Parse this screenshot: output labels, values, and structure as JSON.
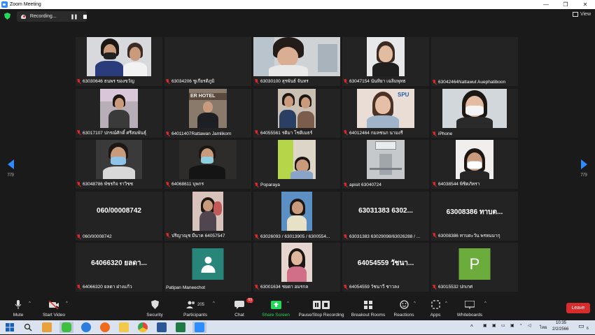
{
  "window": {
    "title": "Zoom Meeting"
  },
  "topbar": {
    "recording_label": "Recording...",
    "view_label": "View"
  },
  "pager": {
    "left_label": "7/9",
    "right_label": "7/9"
  },
  "participants": [
    {
      "name": "63030646 ธนพร ของขวัญ",
      "kind": "video"
    },
    {
      "name": "63034206 ชูเกียรติภูมิ",
      "kind": "dark"
    },
    {
      "name": "63030100 สุรพันธ์ จันทร",
      "kind": "video"
    },
    {
      "name": "63047154 นันทิยา เฉลิมพุทธ",
      "kind": "video"
    },
    {
      "name": "63042464Nattawut Auephatiboon",
      "kind": "dark"
    },
    {
      "name": "63017107 ปกรณ์ศักดิ์ ศรีสมพันธุ์",
      "kind": "video"
    },
    {
      "name": "64011407Rattawan Jamlikorn",
      "kind": "video",
      "video_caption": "ER HOTEL"
    },
    {
      "name": "64055561 รติมา โชติเมธร์",
      "kind": "video"
    },
    {
      "name": "64012464 กมลชนก นามงรี",
      "kind": "video",
      "video_caption": "SPU"
    },
    {
      "name": "iPhone",
      "kind": "video"
    },
    {
      "name": "63048786 พัชรกิจ ราวิชช",
      "kind": "video"
    },
    {
      "name": "64068611 บุพกร",
      "kind": "video"
    },
    {
      "name": "Poparaya",
      "kind": "video"
    },
    {
      "name": "apisit 63040724",
      "kind": "video"
    },
    {
      "name": "64038544 พิชิตภัทรา",
      "kind": "video"
    },
    {
      "name": "060/00008742",
      "kind": "text",
      "big": "060/00008742"
    },
    {
      "name": "ปริญาณุช มีนาค 64057547",
      "kind": "video"
    },
    {
      "name": "63026093 / 63013905 / 6300554...",
      "kind": "video"
    },
    {
      "name": "63031383 63029098/63026288 / ...",
      "kind": "text",
      "big": "63031383 6302..."
    },
    {
      "name": "63008386 ทาบตะวัน พรหมมากุ",
      "kind": "text",
      "big": "63008386 ทาบต..."
    },
    {
      "name": "64066320 ยลดา ฝางแก้ว",
      "kind": "text",
      "big": "64066320 ยลดา..."
    },
    {
      "name": "Patipan Maneechot",
      "kind": "avatar"
    },
    {
      "name": "63001634 ชยดา อมรกล",
      "kind": "video"
    },
    {
      "name": "64054559 วัชนาวี ชาวลง",
      "kind": "text",
      "big": "64054559 วัชนา..."
    },
    {
      "name": "63015532 ปกเกศ",
      "kind": "letter",
      "letter": "P"
    }
  ],
  "toolbar": {
    "mute": "Mute",
    "start_video": "Start Video",
    "security": "Security",
    "participants": "Participants",
    "participants_count": "205",
    "chat": "Chat",
    "chat_badge": "69",
    "share_screen": "Share Screen",
    "pause_stop_recording": "Pause/Stop Recording",
    "breakout_rooms": "Breakout Rooms",
    "reactions": "Reactions",
    "apps": "Apps",
    "whiteboards": "Whiteboards",
    "leave": "Leave"
  },
  "taskbar": {
    "language": "ไทย",
    "time": "10:35",
    "date": "2/2/2566",
    "notification_count": "6"
  },
  "colors": {
    "accent": "#2d8cff",
    "leave": "#d62c2c",
    "muted_mic": "#e02828",
    "share": "#23d959"
  }
}
